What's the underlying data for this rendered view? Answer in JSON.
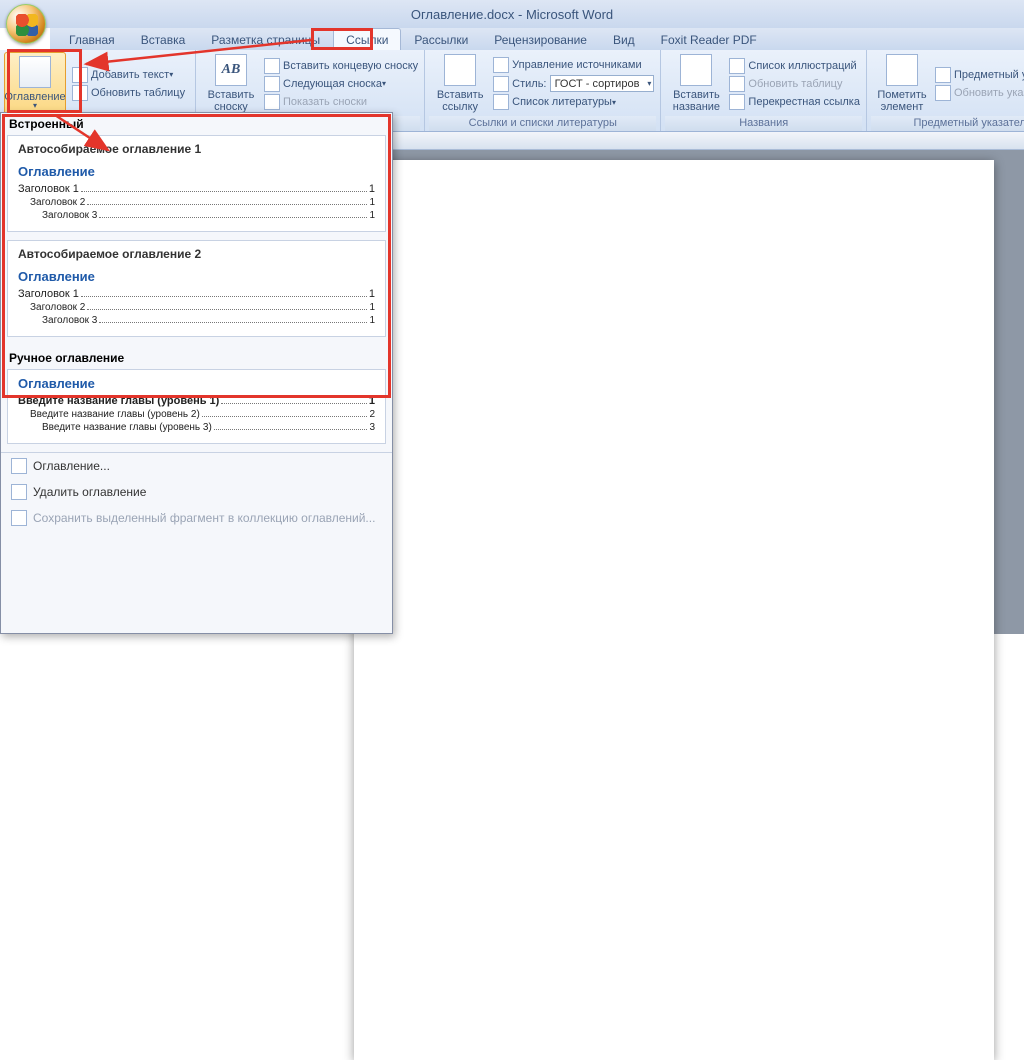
{
  "app": {
    "title": "Оглавление.docx - Microsoft Word"
  },
  "tabs": {
    "items": [
      "Главная",
      "Вставка",
      "Разметка страницы",
      "Ссылки",
      "Рассылки",
      "Рецензирование",
      "Вид",
      "Foxit Reader PDF"
    ],
    "active_index": 3
  },
  "ribbon": {
    "toc": {
      "button": "Оглавление",
      "add_text": "Добавить текст",
      "update": "Обновить таблицу"
    },
    "footnotes": {
      "group": "",
      "big": "Вставить\nсноску",
      "ab": "AB",
      "end": "Вставить концевую сноску",
      "next": "Следующая сноска",
      "show": "Показать сноски"
    },
    "citations": {
      "group": "Ссылки и списки литературы",
      "big": "Вставить\nссылку",
      "manage": "Управление источниками",
      "style_label": "Стиль:",
      "style_value": "ГОСТ - сортиров",
      "bib": "Список литературы"
    },
    "captions": {
      "group": "Названия",
      "big": "Вставить\nназвание",
      "list": "Список иллюстраций",
      "update": "Обновить таблицу",
      "cross": "Перекрестная ссылка"
    },
    "index": {
      "group": "Предметный указатель",
      "big": "Пометить\nэлемент",
      "insert": "Предметный указатель",
      "update": "Обновить указатель"
    }
  },
  "gallery": {
    "builtin": "Встроенный",
    "items": [
      {
        "name": "Автособираемое оглавление 1",
        "title": "Оглавление",
        "lines": [
          [
            "Заголовок 1",
            "1"
          ],
          [
            "Заголовок 2",
            "1"
          ],
          [
            "Заголовок 3",
            "1"
          ]
        ]
      },
      {
        "name": "Автособираемое оглавление 2",
        "title": "Оглавление",
        "lines": [
          [
            "Заголовок 1",
            "1"
          ],
          [
            "Заголовок 2",
            "1"
          ],
          [
            "Заголовок 3",
            "1"
          ]
        ]
      }
    ],
    "manual": {
      "section": "Ручное оглавление",
      "title": "Оглавление",
      "lines": [
        [
          "Введите название главы (уровень 1)",
          "1"
        ],
        [
          "Введите название главы (уровень 2)",
          "2"
        ],
        [
          "Введите название главы (уровень 3)",
          "3"
        ]
      ]
    },
    "cmd_custom": "Оглавление...",
    "cmd_remove": "Удалить оглавление",
    "cmd_save": "Сохранить выделенный фрагмент в коллекцию оглавлений..."
  }
}
